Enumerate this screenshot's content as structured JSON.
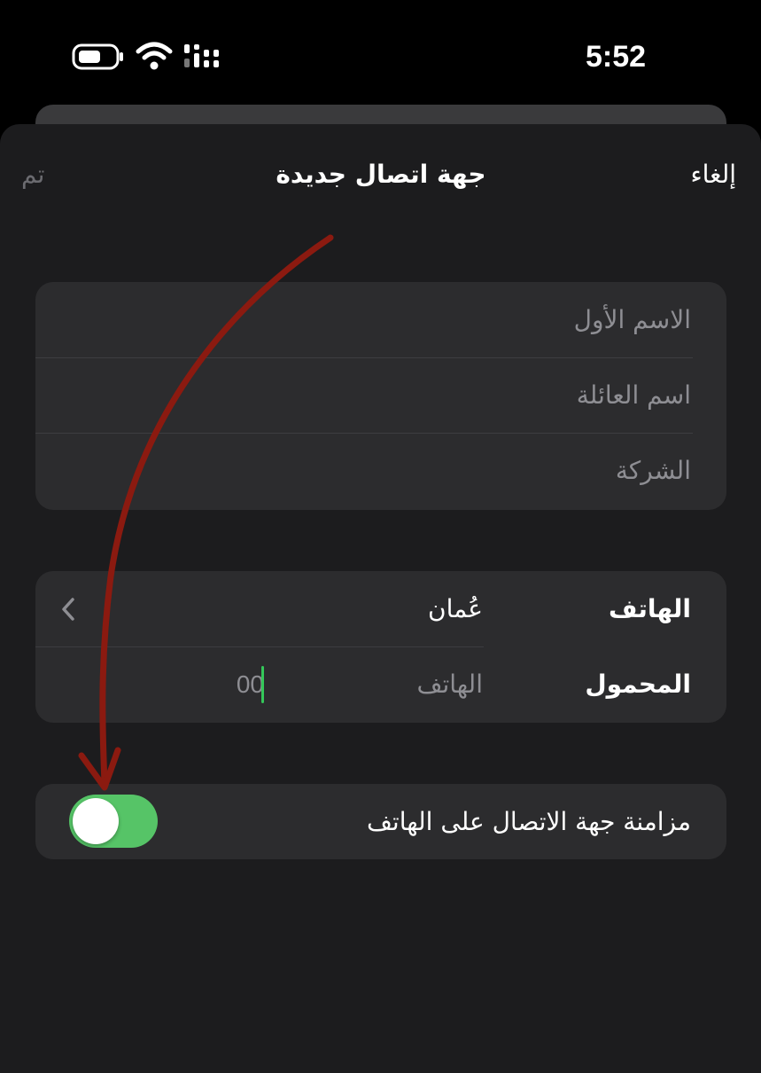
{
  "status_bar": {
    "time": "5:52"
  },
  "nav": {
    "cancel": "إلغاء",
    "title": "جهة اتصال جديدة",
    "done": "تم"
  },
  "name_fields": [
    {
      "placeholder": "الاسم الأول"
    },
    {
      "placeholder": "اسم العائلة"
    },
    {
      "placeholder": "الشركة"
    }
  ],
  "phone": {
    "label": "الهاتف",
    "country": "عُمان",
    "mobile_label": "المحمول",
    "number_placeholder": "الهاتف",
    "number_value": "00"
  },
  "sync": {
    "label": "مزامنة جهة الاتصال على الهاتف",
    "enabled": true
  },
  "colors": {
    "accent_green": "#56c467",
    "annotation_red": "#8b1a10",
    "sheet_bg": "#1c1c1e",
    "group_bg": "#2c2c2e"
  }
}
